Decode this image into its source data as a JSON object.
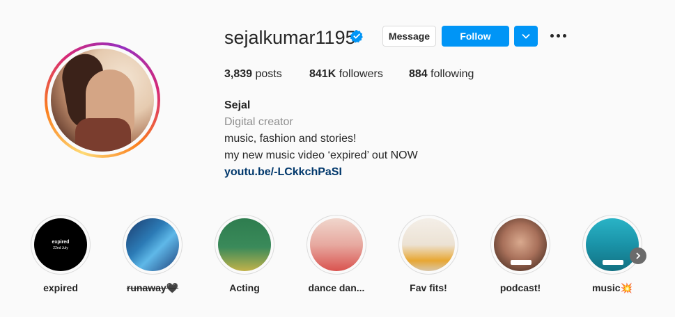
{
  "profile": {
    "username": "sejalkumar1195",
    "verified_icon": "verified-badge-icon",
    "buttons": {
      "message": "Message",
      "follow": "Follow",
      "dropdown_icon": "chevron-down-icon",
      "more_icon": "more-options-icon"
    },
    "stats": {
      "posts_count": "3,839",
      "posts_label": "posts",
      "followers_count": "841K",
      "followers_label": "followers",
      "following_count": "884",
      "following_label": "following"
    },
    "bio": {
      "name": "Sejal",
      "category": "Digital creator",
      "line1": "music, fashion and stories!",
      "line2": "my new music video ‘expired’ out NOW",
      "link": "youtu.be/-LCkkchPaSI"
    }
  },
  "highlights": [
    {
      "label": "expired",
      "cover_text": "expired",
      "cover_subtext": "22nd July"
    },
    {
      "label": "runaway🖤"
    },
    {
      "label": "Acting"
    },
    {
      "label": "dance dan..."
    },
    {
      "label": "Fav fits!"
    },
    {
      "label": "podcast!"
    },
    {
      "label": "music💥"
    }
  ],
  "colors": {
    "accent": "#0095f6",
    "link": "#00376b",
    "muted": "#8e8e8e",
    "text": "#262626",
    "background": "#fafafa"
  }
}
